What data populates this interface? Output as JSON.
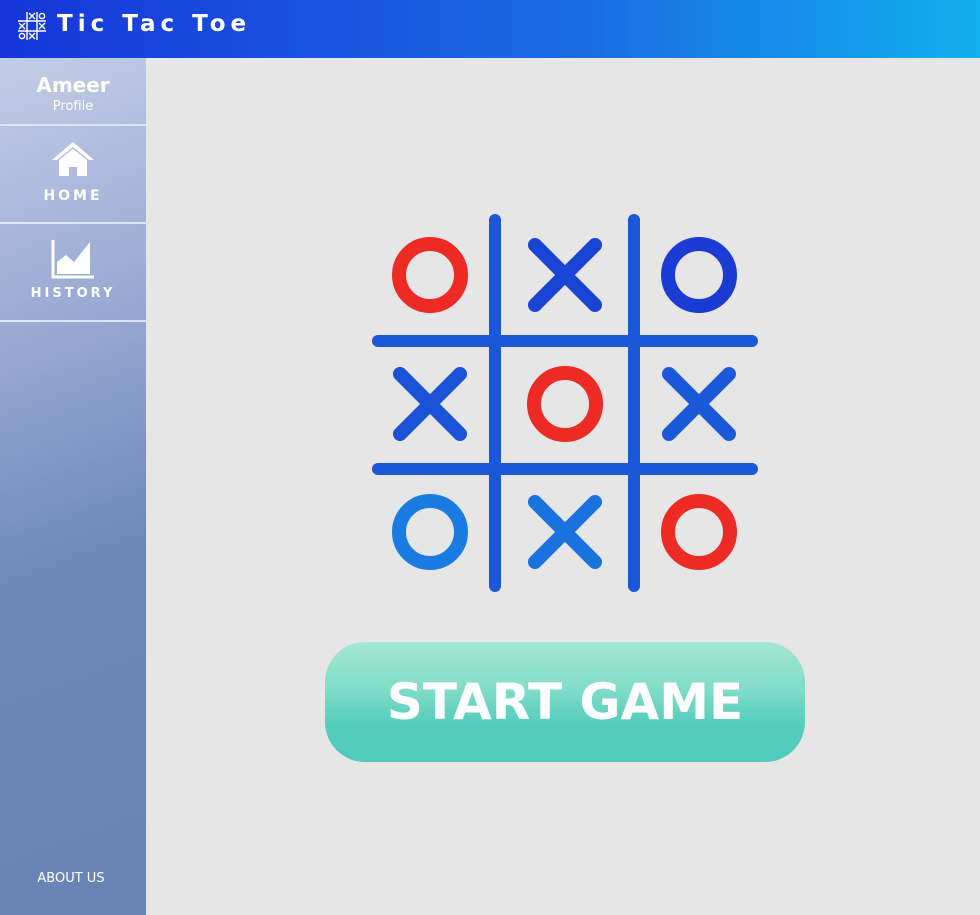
{
  "header": {
    "title": "Tic Tac Toe",
    "logo_icon": "tic-tac-toe-grid-icon",
    "gradient_colors": [
      "#1636d9",
      "#11b0ee"
    ]
  },
  "sidebar": {
    "profile": {
      "name": "Ameer",
      "subtitle": "Profile"
    },
    "items": [
      {
        "label": "HOME",
        "icon": "home-icon"
      },
      {
        "label": "HISTORY",
        "icon": "chart-icon"
      }
    ],
    "footer_link": "ABOUT US"
  },
  "board": {
    "cells": [
      [
        "O",
        "X",
        "O"
      ],
      [
        "X",
        "O",
        "X"
      ],
      [
        "O",
        "X",
        "O"
      ]
    ],
    "cell_colors": [
      [
        "#ee2a25",
        "#1a44d6",
        "#1a3cd4"
      ],
      [
        "#1a52d8",
        "#ee2a25",
        "#1a5ad9"
      ],
      [
        "#1a7ce2",
        "#1a72df",
        "#ee2a25"
      ]
    ],
    "grid_color": "#1a58d8"
  },
  "actions": {
    "start_label": "START GAME",
    "start_color": "#53ccbd"
  }
}
